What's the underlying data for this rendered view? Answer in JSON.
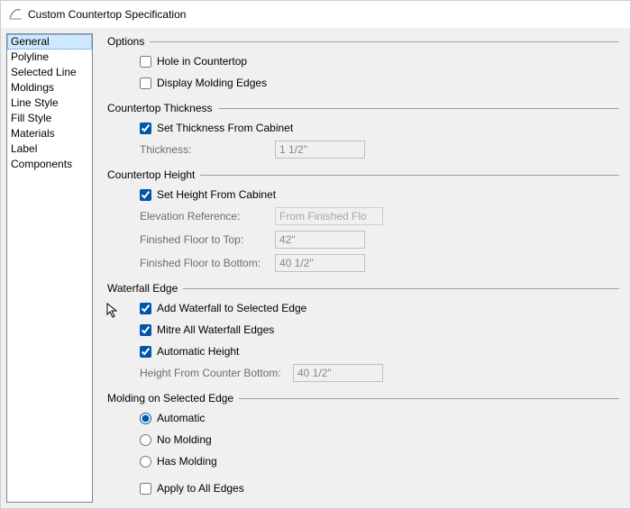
{
  "title": "Custom Countertop Specification",
  "sidebar": {
    "items": [
      {
        "label": "General",
        "selected": true
      },
      {
        "label": "Polyline"
      },
      {
        "label": "Selected Line"
      },
      {
        "label": "Moldings"
      },
      {
        "label": "Line Style"
      },
      {
        "label": "Fill Style"
      },
      {
        "label": "Materials"
      },
      {
        "label": "Label"
      },
      {
        "label": "Components"
      }
    ]
  },
  "groups": {
    "options": {
      "title": "Options",
      "hole_label": "Hole in Countertop",
      "hole_checked": false,
      "molding_label": "Display Molding Edges",
      "molding_checked": false
    },
    "thickness": {
      "title": "Countertop Thickness",
      "set_from_cabinet_label": "Set Thickness From Cabinet",
      "set_from_cabinet_checked": true,
      "thickness_label": "Thickness:",
      "thickness_value": "1 1/2\""
    },
    "height": {
      "title": "Countertop Height",
      "set_from_cabinet_label": "Set Height From Cabinet",
      "set_from_cabinet_checked": true,
      "elevation_ref_label": "Elevation Reference:",
      "elevation_ref_value": "From Finished Floor",
      "ff_top_label": "Finished Floor to Top:",
      "ff_top_value": "42\"",
      "ff_bottom_label": "Finished Floor to Bottom:",
      "ff_bottom_value": "40 1/2\""
    },
    "waterfall": {
      "title": "Waterfall Edge",
      "add_label": "Add Waterfall to Selected Edge",
      "add_checked": true,
      "mitre_label": "Mitre All Waterfall Edges",
      "mitre_checked": true,
      "auto_height_label": "Automatic Height",
      "auto_height_checked": true,
      "height_bottom_label": "Height From Counter Bottom:",
      "height_bottom_value": "40 1/2\""
    },
    "molding_edge": {
      "title": "Molding on Selected Edge",
      "auto_label": "Automatic",
      "none_label": "No Molding",
      "has_label": "Has Molding",
      "selected": "auto",
      "apply_all_label": "Apply to All Edges",
      "apply_all_checked": false
    }
  }
}
